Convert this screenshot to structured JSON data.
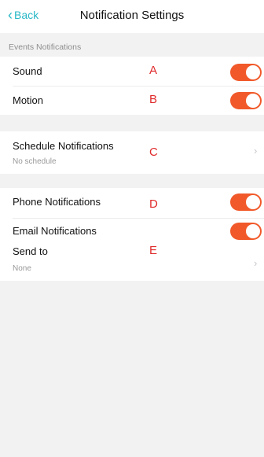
{
  "nav": {
    "back_label": "Back",
    "title": "Notification Settings"
  },
  "events": {
    "header": "Events Notifications",
    "sound_label": "Sound",
    "sound_marker": "A",
    "sound_on": true,
    "motion_label": "Motion",
    "motion_marker": "B",
    "motion_on": true
  },
  "schedule": {
    "label": "Schedule Notifications",
    "sub": "No schedule",
    "marker": "C"
  },
  "channels": {
    "phone_label": "Phone Notifications",
    "phone_marker": "D",
    "phone_on": true,
    "email_label": "Email Notifications",
    "email_on": true,
    "send_to_label": "Send to",
    "send_to_marker": "E",
    "send_to_value": "None"
  },
  "colors": {
    "accent_back": "#2ab8c6",
    "toggle_on": "#f1592a",
    "marker": "#e02a2a"
  }
}
